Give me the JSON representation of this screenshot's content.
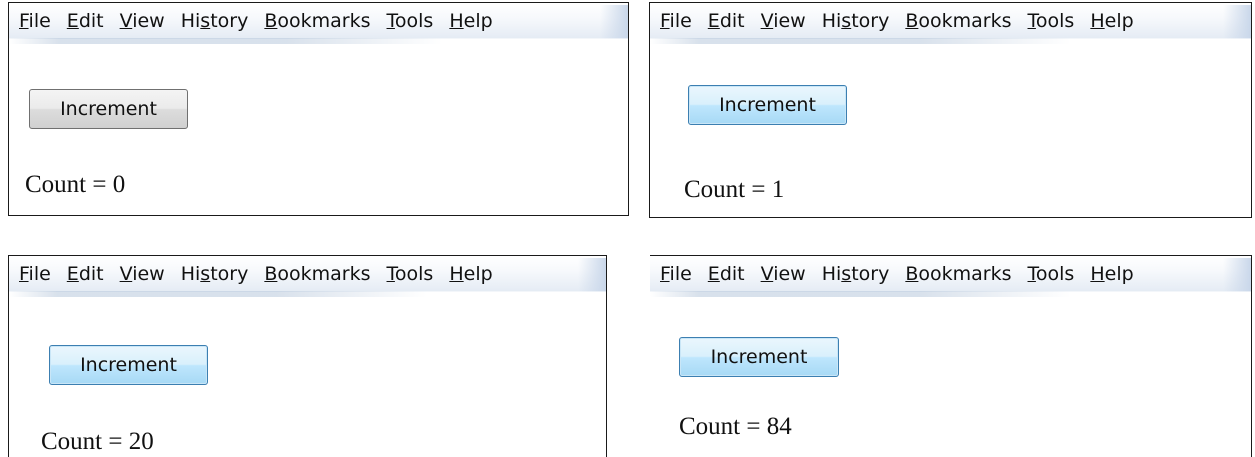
{
  "menu": [
    {
      "pre": "",
      "u": "F",
      "post": "ile"
    },
    {
      "pre": "",
      "u": "E",
      "post": "dit"
    },
    {
      "pre": "",
      "u": "V",
      "post": "iew"
    },
    {
      "pre": "Hi",
      "u": "s",
      "post": "tory"
    },
    {
      "pre": "",
      "u": "B",
      "post": "ookmarks"
    },
    {
      "pre": "",
      "u": "T",
      "post": "ools"
    },
    {
      "pre": "",
      "u": "H",
      "post": "elp"
    }
  ],
  "button_label": "Increment",
  "panels": [
    {
      "count_text": "Count = 0",
      "button_state": "normal"
    },
    {
      "count_text": "Count = 1",
      "button_state": "hover"
    },
    {
      "count_text": "Count = 20",
      "button_state": "hover"
    },
    {
      "count_text": "Count = 84",
      "button_state": "hover"
    }
  ]
}
